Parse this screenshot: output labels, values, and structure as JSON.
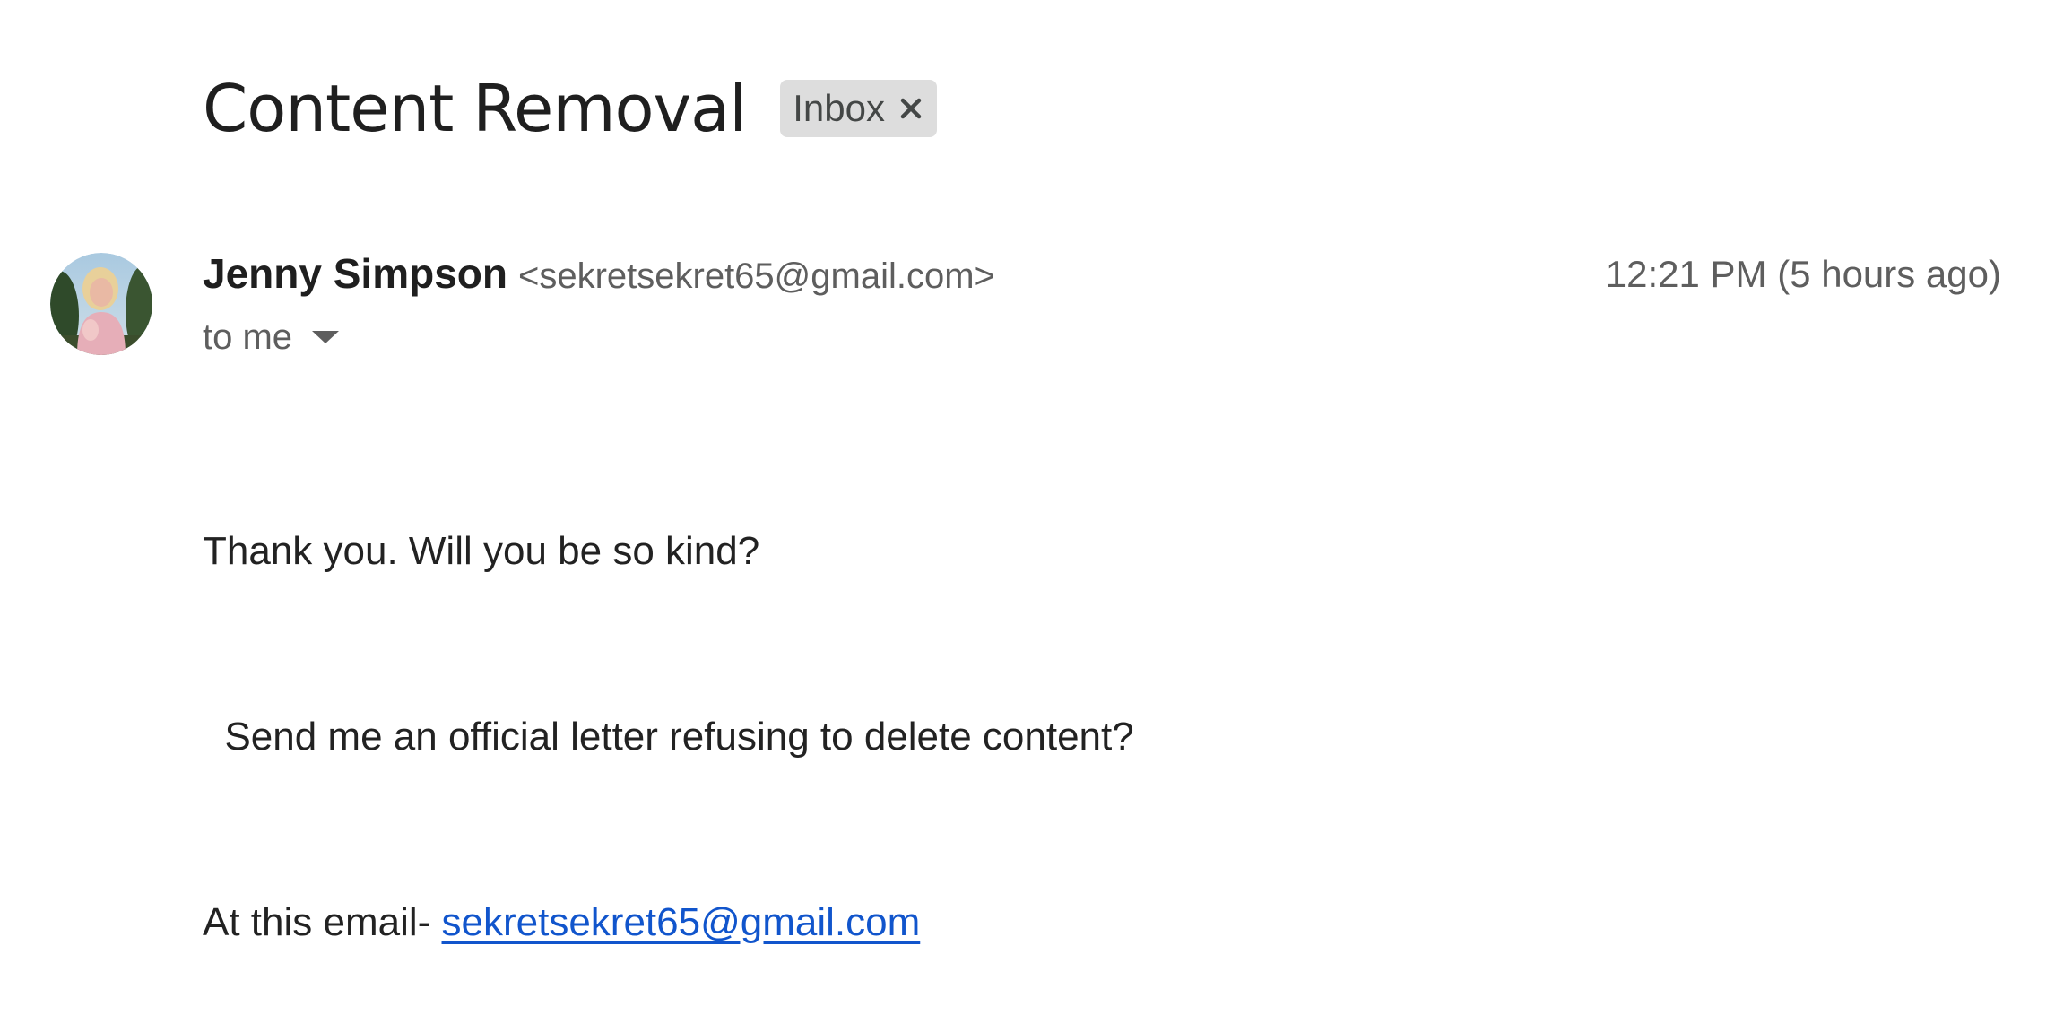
{
  "email": {
    "subject": "Content Removal",
    "label_chip": {
      "text": "Inbox",
      "close_icon": "close-icon"
    },
    "sender": {
      "name": "Jenny Simpson",
      "email": "<sekretsekret65@gmail.com>",
      "avatar_icon": "avatar-photo"
    },
    "timestamp": "12:21 PM (5 hours ago)",
    "recipient": {
      "text": "to me",
      "expand_icon": "caret-down-icon"
    },
    "body": {
      "line1": "Thank you. Will you be so kind?",
      "line2": "  Send me an official letter refusing to delete content?",
      "line3_prefix": "At this email- ",
      "line3_link": "sekretsekret65@gmail.com"
    }
  },
  "colors": {
    "chip_bg": "#dddddd",
    "link": "#1155cc",
    "secondary_text": "#5e5e5e"
  }
}
